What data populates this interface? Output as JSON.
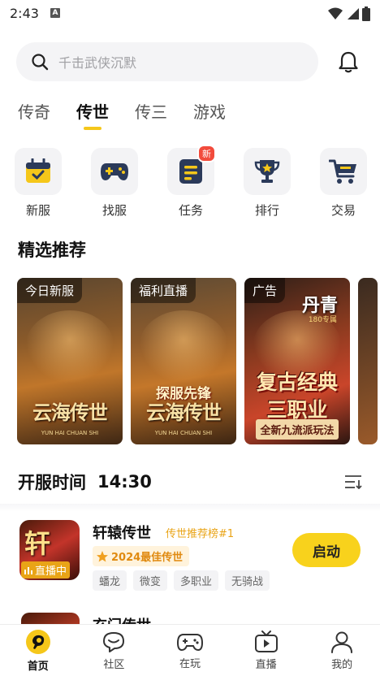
{
  "status_bar": {
    "time": "2:43",
    "notification_letter": "A"
  },
  "search": {
    "placeholder": "千击武侠沉默"
  },
  "tabs": [
    {
      "label": "传奇",
      "active": false
    },
    {
      "label": "传世",
      "active": true
    },
    {
      "label": "传三",
      "active": false
    },
    {
      "label": "游戏",
      "active": false
    }
  ],
  "quick_actions": [
    {
      "label": "新服",
      "icon": "calendar-check-icon"
    },
    {
      "label": "找服",
      "icon": "gamepad-icon"
    },
    {
      "label": "任务",
      "icon": "task-list-icon",
      "badge": "新"
    },
    {
      "label": "排行",
      "icon": "trophy-icon"
    },
    {
      "label": "交易",
      "icon": "cart-icon"
    }
  ],
  "featured": {
    "title": "精选推荐",
    "cards": [
      {
        "tag": "今日新服",
        "title": "云海传世",
        "subtitle": "YUN HAI CHUAN SHI"
      },
      {
        "tag": "福利直播",
        "overlay": "探服先锋",
        "title": "云海传世",
        "subtitle": "YUN HAI CHUAN SHI"
      },
      {
        "tag": "广告",
        "top": "丹青",
        "top_sub": "180专属",
        "main_line1": "复古经典",
        "main_line2": "三职业",
        "footer": "全新九流派玩法"
      }
    ]
  },
  "open_time": {
    "label": "开服时间",
    "time": "14:30"
  },
  "game": {
    "icon_text": "轩",
    "live": "直播中",
    "name": "轩辕传世",
    "rank": "传世推荐榜#1",
    "best": "2024最佳传世",
    "tags": [
      "蟠龙",
      "微变",
      "多职业",
      "无骑战"
    ],
    "action": "启动"
  },
  "next_game": {
    "name": "玄门传世"
  },
  "nav": [
    {
      "label": "首页",
      "icon": "home-logo-icon",
      "active": true
    },
    {
      "label": "社区",
      "icon": "community-icon",
      "active": false
    },
    {
      "label": "在玩",
      "icon": "gamepad-nav-icon",
      "active": false
    },
    {
      "label": "直播",
      "icon": "tv-live-icon",
      "active": false
    },
    {
      "label": "我的",
      "icon": "profile-icon",
      "active": false
    }
  ],
  "colors": {
    "accent": "#f8d21c",
    "badge_red": "#f24b3c",
    "rank_orange": "#e9a417"
  }
}
